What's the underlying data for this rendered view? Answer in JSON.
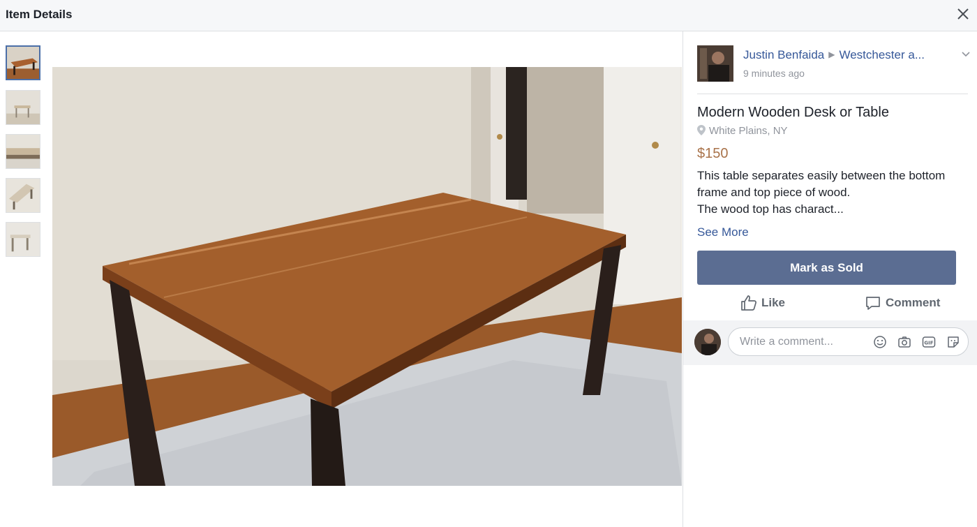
{
  "header": {
    "title": "Item Details"
  },
  "seller": {
    "name": "Justin Benfaida",
    "group": "Westchester a...",
    "time": "9 minutes ago"
  },
  "item": {
    "title": "Modern Wooden Desk or Table",
    "location": "White Plains, NY",
    "price": "$150",
    "description": "This table separates easily between the bottom frame and top piece of wood.\nThe wood top has charact...",
    "see_more": "See More"
  },
  "actions": {
    "mark_sold": "Mark as Sold",
    "like": "Like",
    "comment": "Comment"
  },
  "comment_box": {
    "placeholder": "Write a comment..."
  },
  "icons": [
    "close-icon",
    "chevron-down-icon",
    "location-pin-icon",
    "like-icon",
    "comment-icon",
    "emoji-icon",
    "camera-icon",
    "gif-icon",
    "sticker-icon"
  ],
  "colors": {
    "accent": "#5b6d92",
    "link": "#365899",
    "price": "#a9734a",
    "muted": "#90949c"
  },
  "thumbnails_count": 5,
  "active_thumbnail": 1
}
